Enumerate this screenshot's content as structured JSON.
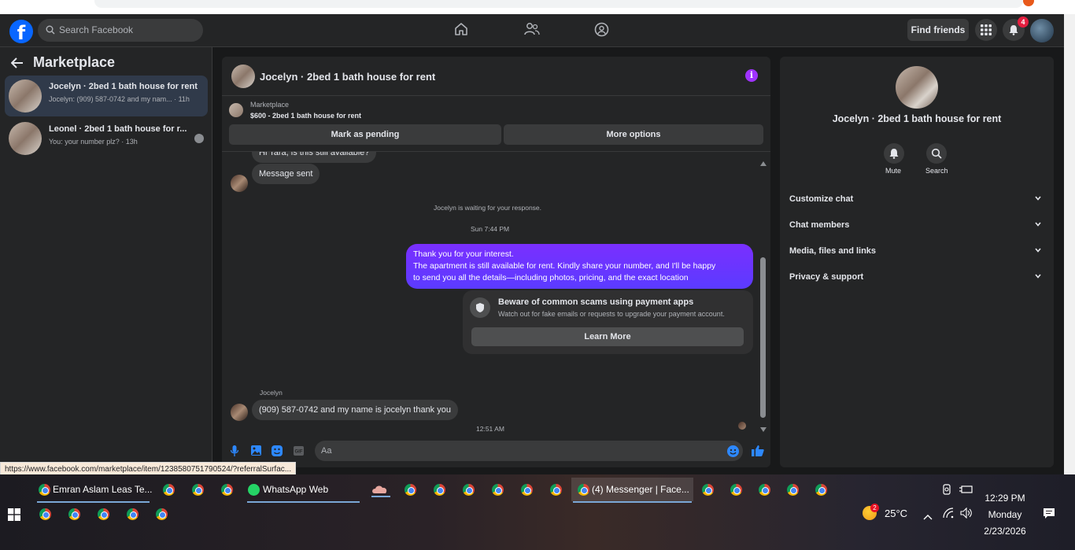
{
  "header": {
    "logo": "f",
    "search_placeholder": "Search Facebook",
    "find_friends": "Find friends",
    "notification_count": "4"
  },
  "sidebar": {
    "title": "Marketplace",
    "conversations": [
      {
        "title": "Jocelyn · 2bed 1 bath house for rent",
        "subtitle": "Jocelyn: (909) 587-0742 and my nam... · 11h"
      },
      {
        "title": "Leonel · 2bed 1 bath house for r...",
        "subtitle": "You: your number plz? · 13h"
      }
    ]
  },
  "chat": {
    "title": "Jocelyn · 2bed 1 bath house for rent",
    "info_glyph": "i",
    "listing_category": "Marketplace",
    "listing_title": "$600 - 2bed 1 bath house for rent",
    "mark_pending": "Mark as pending",
    "more_options": "More options",
    "partial_message": "Hi Tara, is this still available?",
    "message_sent": "Message sent",
    "waiting_notice": "Jocelyn is waiting for your response.",
    "timestamp_1": "Sun 7:44 PM",
    "outgoing_lines": [
      "Thank you for your interest.",
      "The apartment is still available for rent. Kindly share your number, and I'll be happy",
      "to send you all the details—including photos, pricing, and the exact location"
    ],
    "scam_title": "Beware of common scams using payment apps",
    "scam_subtitle": "Watch out for fake emails or requests to upgrade your payment account.",
    "learn_more": "Learn More",
    "timestamp_2": "12:51 AM",
    "sender_name": "Jocelyn",
    "incoming_message": "(909) 587-0742 and my name is jocelyn thank you",
    "composer_placeholder": "Aa"
  },
  "info_panel": {
    "name": "Jocelyn · 2bed 1 bath house for rent",
    "mute": "Mute",
    "search": "Search",
    "sections": [
      "Customize chat",
      "Chat members",
      "Media, files and links",
      "Privacy & support"
    ]
  },
  "status_url": "https://www.facebook.com/marketplace/item/1238580751790524/?referralSurfac...",
  "taskbar": {
    "app_1": "Emran Aslam Leas Te...",
    "app_2": "WhatsApp Web",
    "app_3": "(4) Messenger | Face...",
    "time": "12:29 PM",
    "day": "Monday",
    "date": "2/23/2026",
    "temperature": "25°C",
    "weather_badge": "2"
  },
  "colors": {
    "accent": "#0866ff",
    "outgoing_bubble": "#6a35ff",
    "info_icon": "#a033ff",
    "notification_badge": "#e41e3f"
  }
}
